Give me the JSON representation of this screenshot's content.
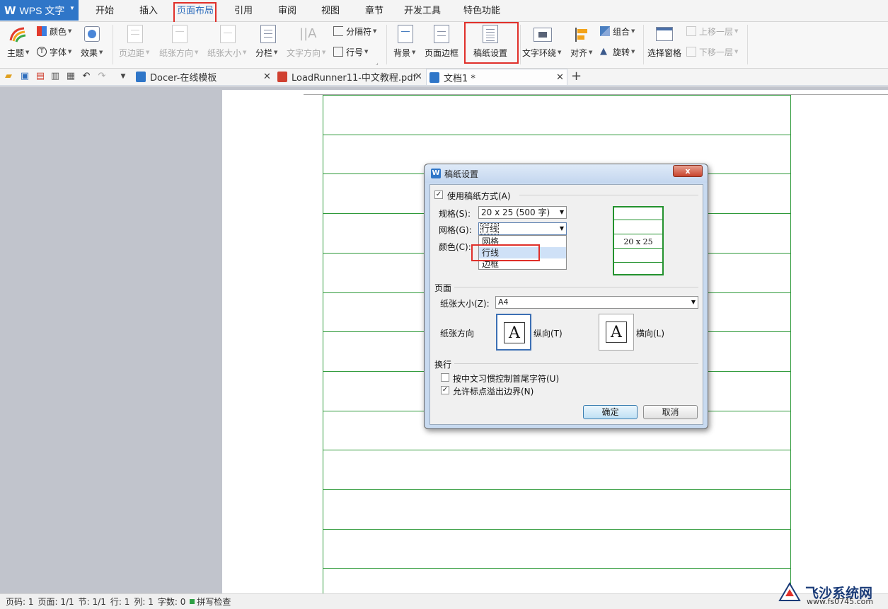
{
  "app": {
    "name": "WPS 文字"
  },
  "menu": {
    "tabs": [
      "开始",
      "插入",
      "页面布局",
      "引用",
      "审阅",
      "视图",
      "章节",
      "开发工具",
      "特色功能"
    ],
    "active": "页面布局"
  },
  "ribbon": {
    "theme": "主题",
    "color": "颜色",
    "font": "字体",
    "effect": "效果",
    "margin": "页边距",
    "orientation": "纸张方向",
    "size": "纸张大小",
    "columns": "分栏",
    "text_direction": "文字方向",
    "breaks": "分隔符",
    "line_number": "行号",
    "background": "背景",
    "page_border": "页面边框",
    "manuscript_setup": "稿纸设置",
    "text_wrap": "文字环绕",
    "align": "对齐",
    "group": "组合",
    "rotate": "旋转",
    "selection_pane": "选择窗格",
    "bring_forward": "上移一层",
    "send_backward": "下移一层"
  },
  "tabs": [
    {
      "label": "Docer-在线模板",
      "active": false
    },
    {
      "label": "LoadRunner11-中文教程.pdf",
      "active": false
    },
    {
      "label": "文档1 *",
      "active": true
    }
  ],
  "dialog": {
    "title": "稿纸设置",
    "close": "x",
    "use_manuscript": "使用稿纸方式(A)",
    "use_manuscript_checked": true,
    "spec_label": "规格(S):",
    "spec_value": "20 x 25 (500 字)",
    "grid_label": "网格(G):",
    "grid_value": "行线",
    "grid_options": [
      "网格",
      "行线",
      "边框"
    ],
    "grid_hover": "行线",
    "color_label": "颜色(C):",
    "preview_text": "20 x 25",
    "page_group": "页面",
    "paper_size_label": "纸张大小(Z):",
    "paper_size_value": "A4",
    "orientation_label": "纸张方向",
    "portrait_glyph": "A",
    "portrait_label": "纵向(T)",
    "landscape_glyph": "A",
    "landscape_label": "横向(L)",
    "linebreak_group": "换行",
    "option1": "按中文习惯控制首尾字符(U)",
    "option1_checked": false,
    "option2": "允许标点溢出边界(N)",
    "option2_checked": true,
    "ok": "确定",
    "cancel": "取消"
  },
  "status": {
    "page": "页码: 1",
    "pages": "页面: 1/1",
    "section": "节: 1/1",
    "line": "行: 1",
    "column": "列: 1",
    "words": "字数: 0",
    "spell": "拼写检查"
  },
  "watermark": {
    "title": "飞沙系统网",
    "url": "www.fs0745.com"
  },
  "colors": {
    "accent": "#2f76c8",
    "grid_green": "#2f9a3a",
    "highlight_red": "#e0302a"
  }
}
